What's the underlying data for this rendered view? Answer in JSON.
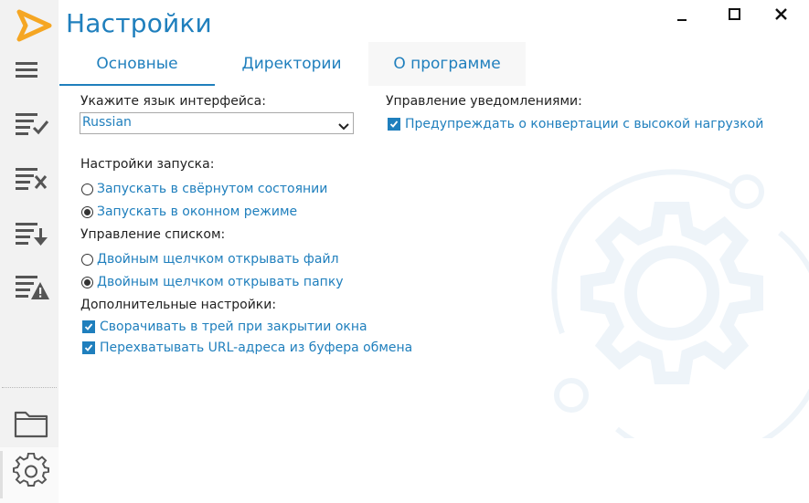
{
  "window": {
    "title": "Настройки"
  },
  "tabs": [
    {
      "label": "Основные",
      "active": true
    },
    {
      "label": "Директории",
      "active": false
    },
    {
      "label": "О программе",
      "active": false
    }
  ],
  "language": {
    "label": "Укажите язык интерфейса:",
    "selected": "Russian"
  },
  "startup": {
    "label": "Настройки запуска:",
    "options": [
      {
        "label": "Запускать в свёрнутом состоянии",
        "selected": false
      },
      {
        "label": "Запускать в оконном режиме",
        "selected": true
      }
    ]
  },
  "list_control": {
    "label": "Управление списком:",
    "options": [
      {
        "label": "Двойным щелчком открывать файл",
        "selected": false
      },
      {
        "label": "Двойным щелчком открывать папку",
        "selected": true
      }
    ]
  },
  "extra": {
    "label": "Дополнительные настройки:",
    "options": [
      {
        "label": "Сворачивать в трей при закрытии окна",
        "checked": true
      },
      {
        "label": "Перехватывать URL-адреса из буфера обмена",
        "checked": true
      }
    ]
  },
  "notifications": {
    "label": "Управление уведомлениями:",
    "options": [
      {
        "label": "Предупреждать о конвертации с высокой нагрузкой",
        "checked": true
      }
    ]
  },
  "colors": {
    "accent": "#1f7fbd",
    "logo": "#f5a623",
    "sidebar_bg": "#f2f2f2",
    "icon_gray": "#555555"
  }
}
